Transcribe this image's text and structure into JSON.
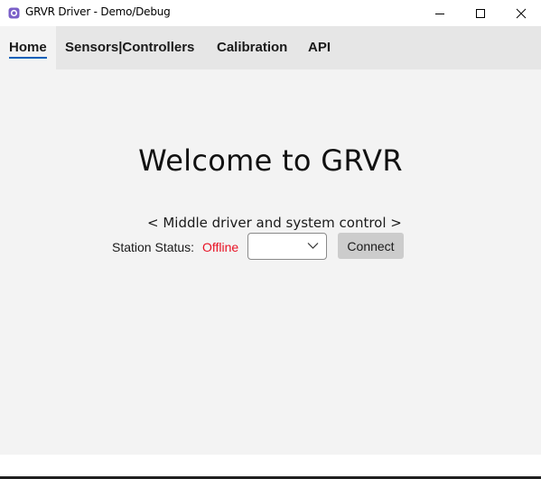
{
  "window": {
    "title": "GRVR Driver - Demo/Debug",
    "icon": "app-icon",
    "controls": [
      "minimize-icon",
      "maximize-icon",
      "close-icon"
    ]
  },
  "nav": {
    "tabs": [
      {
        "label": "Home",
        "selected": true
      },
      {
        "label": "Sensors|Controllers",
        "selected": false
      },
      {
        "label": "Calibration",
        "selected": false
      },
      {
        "label": "API",
        "selected": false
      }
    ],
    "accent": "#005fb8"
  },
  "home": {
    "welcome": "Welcome to GRVR",
    "subtitle": "< Middle driver and system control >",
    "status_label": "Station Status:",
    "status_value": "Offline",
    "status_color": "#e81123",
    "station_select_value": "",
    "connect_label": "Connect"
  }
}
